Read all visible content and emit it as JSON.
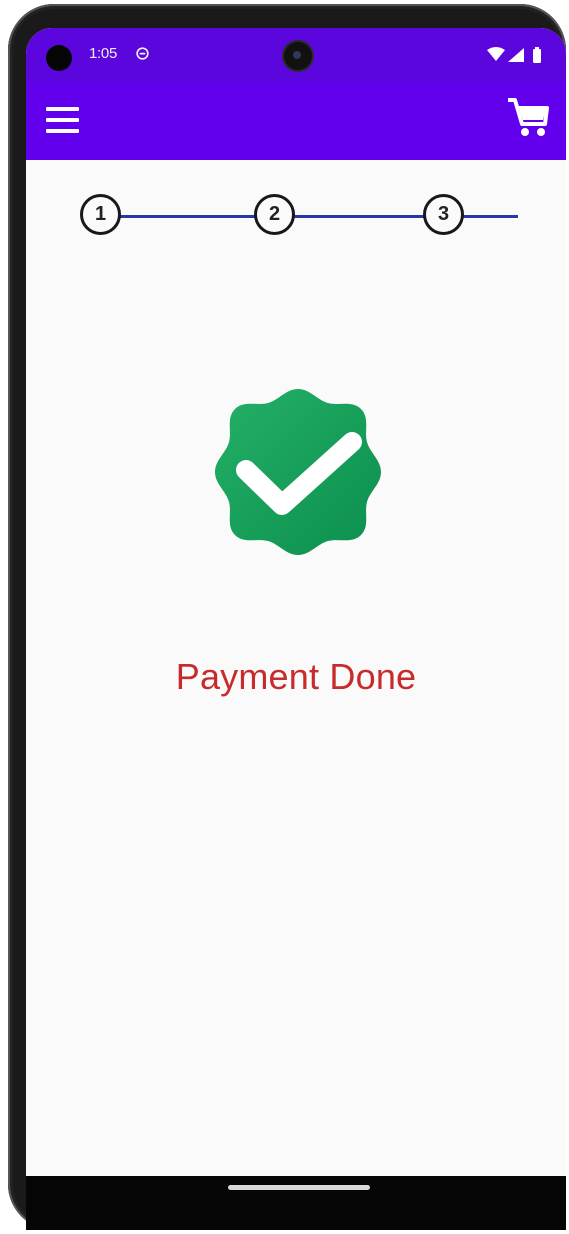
{
  "status_bar": {
    "time": "1:05",
    "dnd_icon": "do-not-disturb-icon",
    "wifi_icon": "wifi-icon",
    "signal_icon": "cellular-signal-icon",
    "battery_icon": "battery-icon"
  },
  "app_bar": {
    "color": "#6200ee",
    "menu_icon": "hamburger-menu-icon",
    "cart_icon": "shopping-cart-icon"
  },
  "stepper": {
    "steps": [
      "1",
      "2",
      "3"
    ],
    "line_color": "#2637a8"
  },
  "success": {
    "icon": "verified-check-badge-icon",
    "message": "Payment Done",
    "message_color": "#c72b2b",
    "badge_color": "#18a862"
  }
}
